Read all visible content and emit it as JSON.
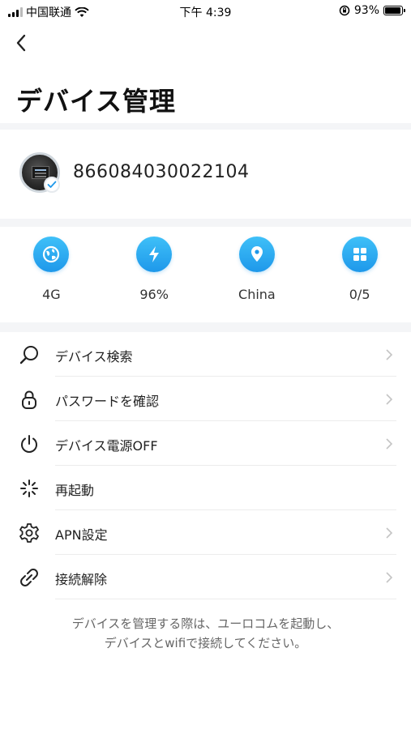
{
  "status_bar": {
    "carrier": "中国联通",
    "time": "下午 4:39",
    "battery": "93%",
    "battery_level": 0.93
  },
  "header": {
    "title": "デバイス管理"
  },
  "device": {
    "id": "866084030022104"
  },
  "stats": [
    {
      "icon": "globe-icon",
      "label": "4G"
    },
    {
      "icon": "lightning-icon",
      "label": "96%"
    },
    {
      "icon": "location-pin-icon",
      "label": "China"
    },
    {
      "icon": "grid-icon",
      "label": "0/5"
    }
  ],
  "menu": {
    "items": [
      {
        "icon": "search-icon",
        "label": "デバイス検索",
        "chevron": true
      },
      {
        "icon": "lock-icon",
        "label": "パスワードを確認",
        "chevron": true
      },
      {
        "icon": "power-icon",
        "label": "デバイス電源OFF",
        "chevron": true
      },
      {
        "icon": "restart-icon",
        "label": "再起動",
        "chevron": false
      },
      {
        "icon": "gear-icon",
        "label": "APN設定",
        "chevron": true
      },
      {
        "icon": "unlink-icon",
        "label": "接続解除",
        "chevron": true
      }
    ]
  },
  "footer": {
    "note_line1": "デバイスを管理する際は、ユーロコムを起動し、",
    "note_line2": "デバイスとwifiで接続してください。"
  },
  "colors": {
    "accent": "#1e98ea",
    "accent_light": "#3fc0f8",
    "band": "#f4f5f7"
  }
}
